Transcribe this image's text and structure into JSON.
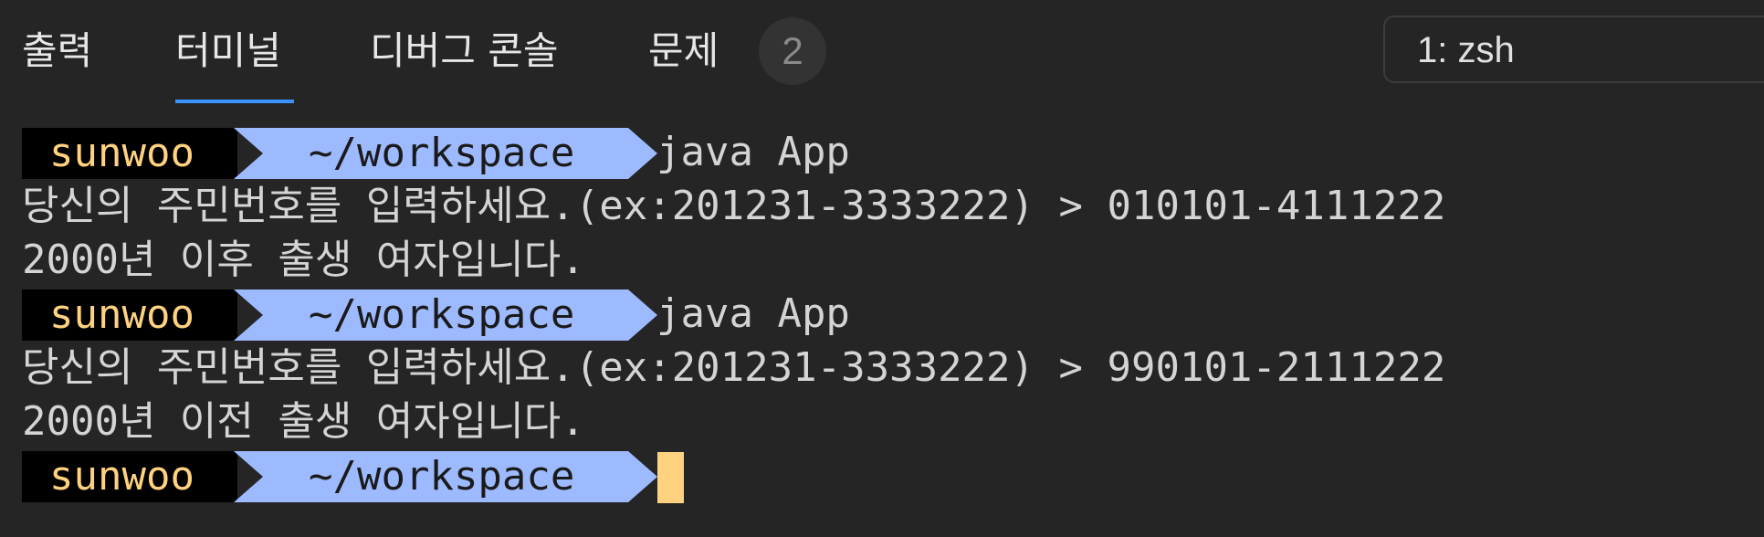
{
  "tabs": [
    {
      "label": "출력"
    },
    {
      "label": "터미널"
    },
    {
      "label": "디버그 콘솔"
    },
    {
      "label": "문제"
    }
  ],
  "active_tab": "터미널",
  "problems_badge": "2",
  "terminal_selector": {
    "value": "1: zsh"
  },
  "colors": {
    "background": "#252526",
    "active_tab_underline": "#3794ff",
    "prompt_user_bg": "#000000",
    "prompt_user_fg": "#ffd280",
    "prompt_path_bg": "#9ebaff",
    "cursor": "#ffd280"
  },
  "terminal": {
    "lines": [
      {
        "type": "prompt",
        "user": "sunwoo",
        "path": "~/workspace",
        "command": "java App"
      },
      {
        "type": "output",
        "text": "당신의 주민번호를 입력하세요.(ex:201231-3333222) > 010101-4111222"
      },
      {
        "type": "output",
        "text": "2000년 이후 출생 여자입니다."
      },
      {
        "type": "prompt",
        "user": "sunwoo",
        "path": "~/workspace",
        "command": "java App"
      },
      {
        "type": "output",
        "text": "당신의 주민번호를 입력하세요.(ex:201231-3333222) > 990101-2111222"
      },
      {
        "type": "output",
        "text": "2000년 이전 출생 여자입니다."
      },
      {
        "type": "prompt",
        "user": "sunwoo",
        "path": "~/workspace",
        "command": ""
      }
    ]
  }
}
